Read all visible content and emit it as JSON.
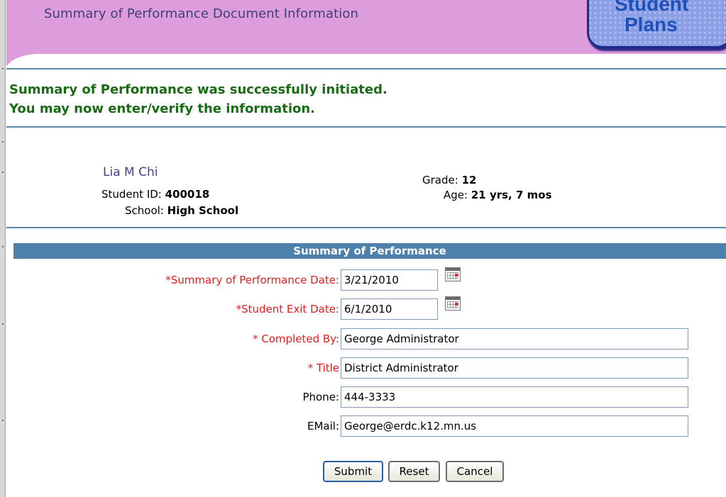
{
  "header": {
    "title": "Summary of Performance Document Information",
    "logo_line1": "Student",
    "logo_line2": "Plans"
  },
  "message": {
    "line1": "Summary of Performance was successfully initiated.",
    "line2": "You may now enter/verify the information."
  },
  "student": {
    "name": "Lia M Chi",
    "id_label": "Student ID:",
    "id_value": "400018",
    "school_label": "School:",
    "school_value": "High School",
    "grade_label": "Grade:",
    "grade_value": "12",
    "age_label": "Age:",
    "age_value": "21 yrs, 7 mos"
  },
  "section": {
    "title": "Summary of Performance"
  },
  "form": {
    "sop_date": {
      "label": "*Summary of Performance Date:",
      "value": "3/21/2010"
    },
    "exit_date": {
      "label": "*Student Exit Date:",
      "value": "6/1/2010"
    },
    "completed_by": {
      "label": "* Completed By:",
      "value": "George Administrator"
    },
    "title": {
      "label": "* Title",
      "value": "District Administrator"
    },
    "phone": {
      "label": "Phone:",
      "value": "444-3333"
    },
    "email": {
      "label": "EMail:",
      "value": "George@erdc.k12.mn.us"
    }
  },
  "buttons": {
    "submit": "Submit",
    "reset": "Reset",
    "cancel": "Cancel"
  },
  "colors": {
    "header_bg": "#dd9ddd",
    "success_text": "#1a6b16",
    "required_label": "#e11d1d",
    "section_bar": "#4d81ac",
    "rule": "#5d87a6"
  }
}
